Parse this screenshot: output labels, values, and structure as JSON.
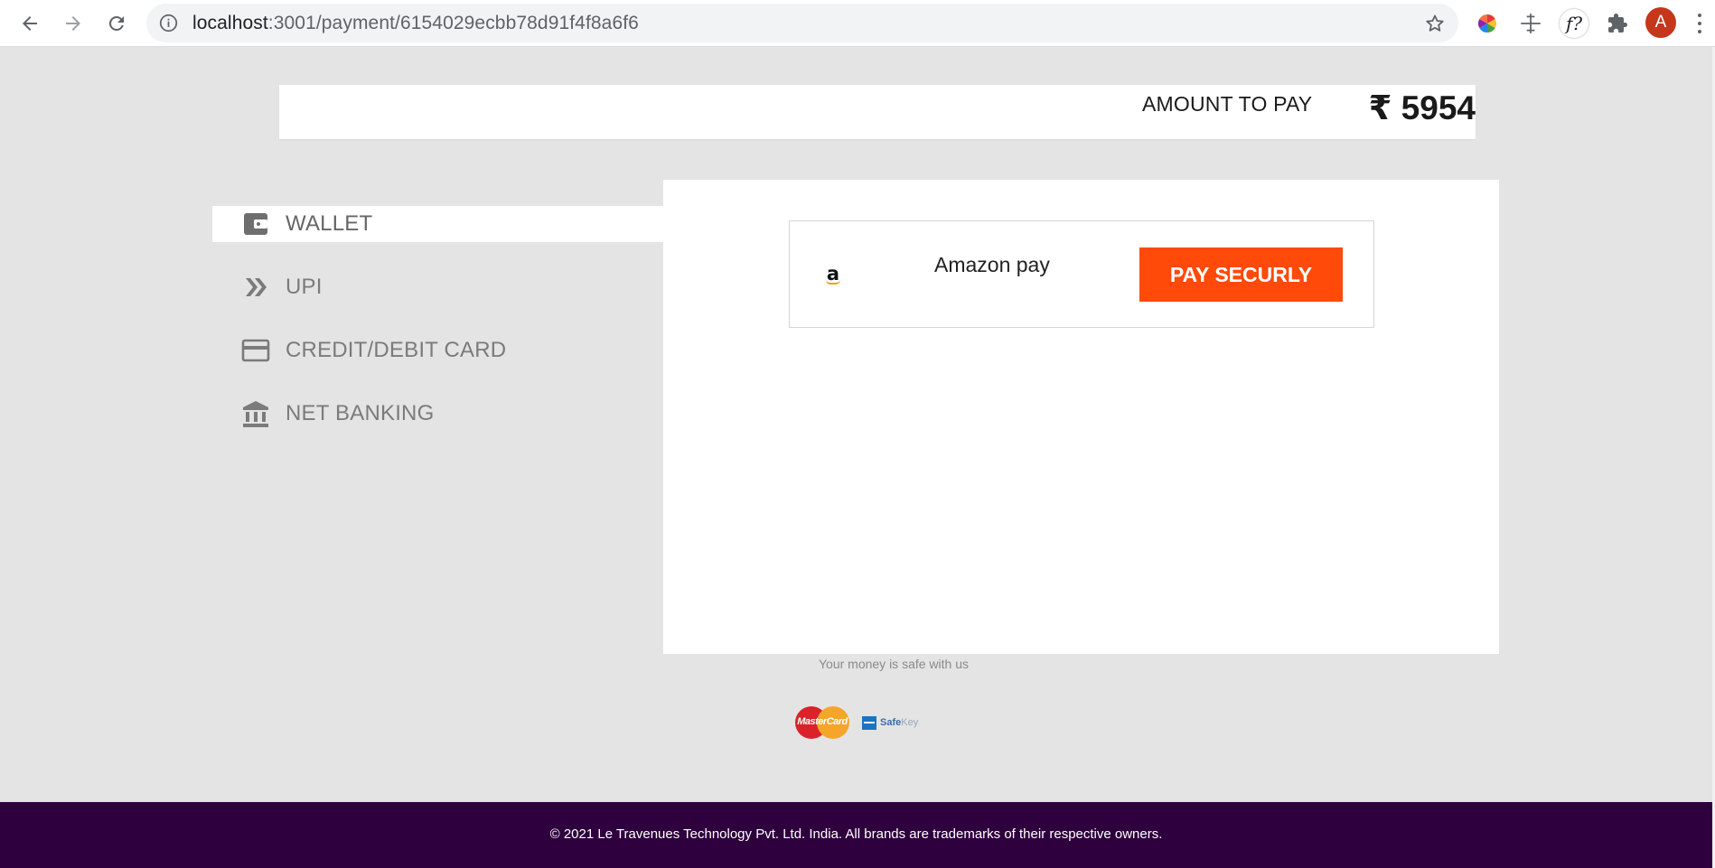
{
  "browser": {
    "url_host": "localhost",
    "url_path": ":3001/payment/6154029ecbb78d91f4f8a6f6",
    "avatar_letter": "A",
    "extensions": [
      "color-wheel-icon",
      "move-icon",
      "font-identifier-icon",
      "puzzle-icon"
    ]
  },
  "amount": {
    "label": "AMOUNT TO PAY",
    "value": "₹ 5954"
  },
  "sidebar": {
    "items": [
      {
        "label": "WALLET",
        "icon": "wallet-icon",
        "active": true
      },
      {
        "label": "UPI",
        "icon": "double-chevron-icon",
        "active": false
      },
      {
        "label": "CREDIT/DEBIT CARD",
        "icon": "credit-card-icon",
        "active": false
      },
      {
        "label": "NET BANKING",
        "icon": "bank-icon",
        "active": false
      }
    ]
  },
  "wallet_option": {
    "logo_letter": "a",
    "label": "Amazon pay",
    "button_label": "PAY SECURLY",
    "button_color": "#ff4a0a"
  },
  "trust": {
    "safe_text": "Your money is safe with us",
    "mastercard_text": "MasterCard",
    "safekey_text": "Safe",
    "safekey_text_2": "Key"
  },
  "footer": {
    "text": "© 2021 Le Travenues Technology Pvt. Ltd. India. All brands are trademarks of their respective owners.",
    "background": "#2e003d"
  }
}
